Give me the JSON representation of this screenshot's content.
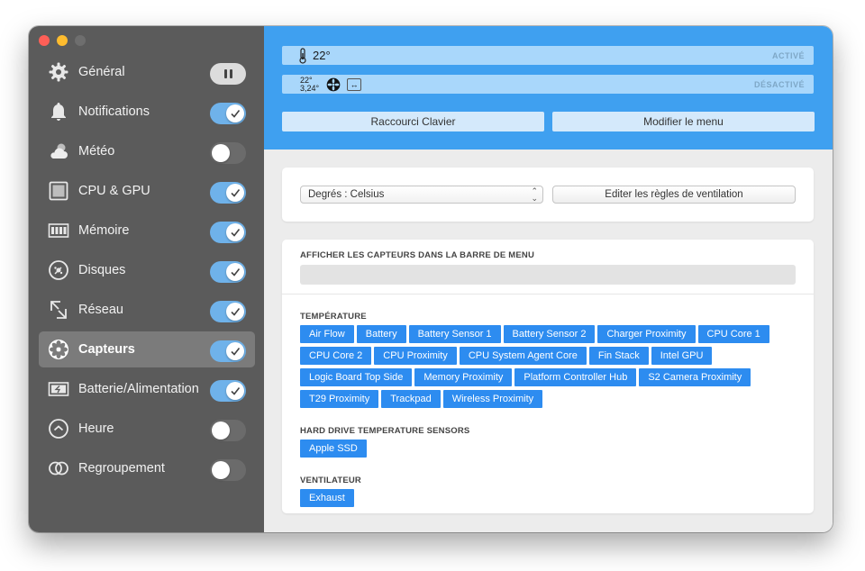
{
  "window": {
    "traffic_lights": [
      "close",
      "minimize",
      "zoom"
    ]
  },
  "sidebar": {
    "items": [
      {
        "label": "Général",
        "icon": "gear-icon",
        "toggle": "pause"
      },
      {
        "label": "Notifications",
        "icon": "bell-icon",
        "toggle": "on"
      },
      {
        "label": "Météo",
        "icon": "weather-icon",
        "toggle": "off"
      },
      {
        "label": "CPU & GPU",
        "icon": "cpu-icon",
        "toggle": "on"
      },
      {
        "label": "Mémoire",
        "icon": "memory-icon",
        "toggle": "on"
      },
      {
        "label": "Disques",
        "icon": "disk-icon",
        "toggle": "on"
      },
      {
        "label": "Réseau",
        "icon": "network-icon",
        "toggle": "on"
      },
      {
        "label": "Capteurs",
        "icon": "fan-icon",
        "toggle": "on",
        "active": true
      },
      {
        "label": "Batterie/Alimentation",
        "icon": "battery-icon",
        "toggle": "on"
      },
      {
        "label": "Heure",
        "icon": "clock-icon",
        "toggle": "off"
      },
      {
        "label": "Regroupement",
        "icon": "group-icon",
        "toggle": "off"
      }
    ]
  },
  "header": {
    "preview1": {
      "temp": "22°",
      "status": "ACTIVÉ"
    },
    "preview2": {
      "temp_top": "22°",
      "temp_bottom": "3,24°",
      "arrows": "↔",
      "status": "DÉSACTIVÉ"
    },
    "shortcut_button": "Raccourci Clavier",
    "edit_menu_button": "Modifier le menu"
  },
  "settings": {
    "unit_select": "Degrés : Celsius",
    "fan_rules_button": "Editer les règles de ventilation"
  },
  "sensors": {
    "menubar_title": "AFFICHER LES CAPTEURS DANS LA BARRE DE MENU",
    "temperature_title": "TEMPÉRATURE",
    "temperature": [
      "Air Flow",
      "Battery",
      "Battery Sensor 1",
      "Battery Sensor 2",
      "Charger Proximity",
      "CPU Core 1",
      "CPU Core 2",
      "CPU Proximity",
      "CPU System Agent Core",
      "Fin Stack",
      "Intel GPU",
      "Logic Board Top Side",
      "Memory Proximity",
      "Platform Controller Hub",
      "S2 Camera Proximity",
      "T29 Proximity",
      "Trackpad",
      "Wireless Proximity"
    ],
    "hdd_title": "HARD DRIVE TEMPERATURE SENSORS",
    "hdd": [
      "Apple SSD"
    ],
    "fan_title": "VENTILATEUR",
    "fan": [
      "Exhaust"
    ]
  },
  "colors": {
    "sidebar_bg": "#5b5b5b",
    "header_bg": "#3fa0f0",
    "toggle_on": "#6fb2ea",
    "chip": "#2d8cf0"
  }
}
